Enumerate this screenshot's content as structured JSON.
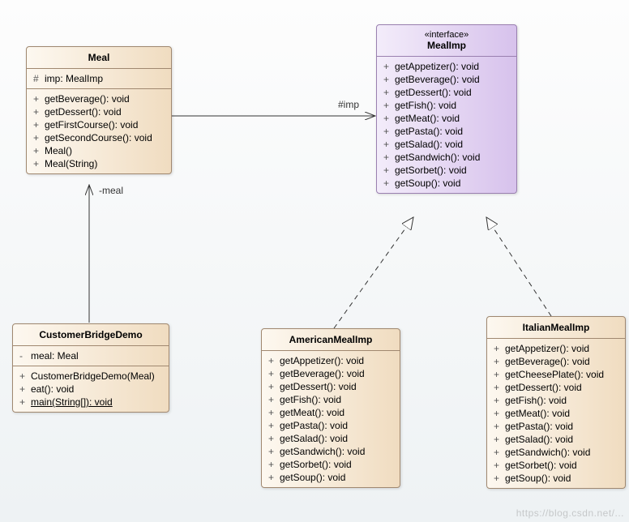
{
  "classes": {
    "meal": {
      "name": "Meal",
      "attrs": [
        {
          "vis": "#",
          "text": "imp: MealImp"
        }
      ],
      "ops": [
        {
          "vis": "+",
          "text": "getBeverage(): void"
        },
        {
          "vis": "+",
          "text": "getDessert(): void"
        },
        {
          "vis": "+",
          "text": "getFirstCourse(): void"
        },
        {
          "vis": "+",
          "text": "getSecondCourse(): void"
        },
        {
          "vis": "+",
          "text": "Meal()"
        },
        {
          "vis": "+",
          "text": "Meal(String)"
        }
      ]
    },
    "mealimp": {
      "stereo": "«interface»",
      "name": "MealImp",
      "ops": [
        {
          "vis": "+",
          "text": "getAppetizer(): void"
        },
        {
          "vis": "+",
          "text": "getBeverage(): void"
        },
        {
          "vis": "+",
          "text": "getDessert(): void"
        },
        {
          "vis": "+",
          "text": "getFish(): void"
        },
        {
          "vis": "+",
          "text": "getMeat(): void"
        },
        {
          "vis": "+",
          "text": "getPasta(): void"
        },
        {
          "vis": "+",
          "text": "getSalad(): void"
        },
        {
          "vis": "+",
          "text": "getSandwich(): void"
        },
        {
          "vis": "+",
          "text": "getSorbet(): void"
        },
        {
          "vis": "+",
          "text": "getSoup(): void"
        }
      ]
    },
    "customer": {
      "name": "CustomerBridgeDemo",
      "attrs": [
        {
          "vis": "-",
          "text": "meal: Meal"
        }
      ],
      "ops": [
        {
          "vis": "+",
          "text": "CustomerBridgeDemo(Meal)"
        },
        {
          "vis": "+",
          "text": "eat(): void"
        },
        {
          "vis": "+",
          "text": "main(String[]): void",
          "underline": true
        }
      ]
    },
    "american": {
      "name": "AmericanMealImp",
      "ops": [
        {
          "vis": "+",
          "text": "getAppetizer(): void"
        },
        {
          "vis": "+",
          "text": "getBeverage(): void"
        },
        {
          "vis": "+",
          "text": "getDessert(): void"
        },
        {
          "vis": "+",
          "text": "getFish(): void"
        },
        {
          "vis": "+",
          "text": "getMeat(): void"
        },
        {
          "vis": "+",
          "text": "getPasta(): void"
        },
        {
          "vis": "+",
          "text": "getSalad(): void"
        },
        {
          "vis": "+",
          "text": "getSandwich(): void"
        },
        {
          "vis": "+",
          "text": "getSorbet(): void"
        },
        {
          "vis": "+",
          "text": "getSoup(): void"
        }
      ]
    },
    "italian": {
      "name": "ItalianMealImp",
      "ops": [
        {
          "vis": "+",
          "text": "getAppetizer(): void"
        },
        {
          "vis": "+",
          "text": "getBeverage(): void"
        },
        {
          "vis": "+",
          "text": "getCheesePlate(): void"
        },
        {
          "vis": "+",
          "text": "getDessert(): void"
        },
        {
          "vis": "+",
          "text": "getFish(): void"
        },
        {
          "vis": "+",
          "text": "getMeat(): void"
        },
        {
          "vis": "+",
          "text": "getPasta(): void"
        },
        {
          "vis": "+",
          "text": "getSalad(): void"
        },
        {
          "vis": "+",
          "text": "getSandwich(): void"
        },
        {
          "vis": "+",
          "text": "getSorbet(): void"
        },
        {
          "vis": "+",
          "text": "getSoup(): void"
        }
      ]
    }
  },
  "labels": {
    "imp": "#imp",
    "meal": "-meal"
  },
  "watermark": "https://blog.csdn.net/..."
}
